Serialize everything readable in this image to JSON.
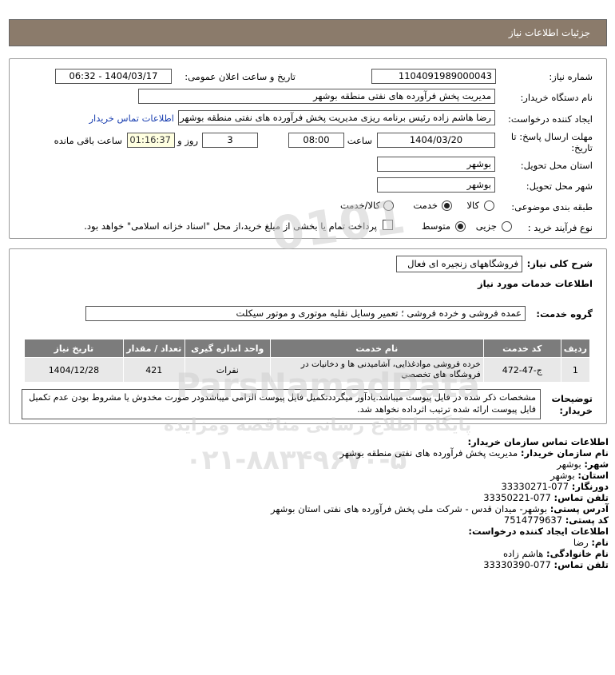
{
  "header": {
    "title": "جزئیات اطلاعات نیاز"
  },
  "need": {
    "number_label": "شماره نیاز:",
    "number_value": "1104091989000043",
    "announce_label": "تاریخ و ساعت اعلان عمومی:",
    "announce_value": "1404/03/17 - 06:32",
    "buyer_label": "نام دستگاه خریدار:",
    "buyer_value": "مدیریت پخش فرآورده های نفتی منطقه بوشهر",
    "creator_label": "ایجاد کننده درخواست:",
    "creator_value": "رضا هاشم زاده رئیس برنامه ریزی مدیریت پخش فرآورده های نفتی منطقه بوشهر",
    "contact_link": "اطلاعات تماس خریدار",
    "deadline_label_1": "مهلت ارسال پاسخ: تا",
    "deadline_label_2": "تاریخ:",
    "deadline_date": "1404/03/20",
    "time_label": "ساعت",
    "deadline_time": "08:00",
    "days_value": "3",
    "days_label": "روز و",
    "timer_value": "01:16:37",
    "remaining_label": "ساعت باقی مانده",
    "province_label": "استان محل تحویل:",
    "province_value": "بوشهر",
    "city_label": "شهر محل تحویل:",
    "city_value": "بوشهر",
    "category_label": "طبقه بندی موضوعی:",
    "category_options": [
      "کالا",
      "خدمت",
      "کالا/خدمت"
    ],
    "process_label": "نوع فرآیند خرید :",
    "process_options": [
      "جزیی",
      "متوسط"
    ],
    "payment_text": "پرداخت تمام یا بخشی از مبلغ خرید،از محل \"اسناد خزانه اسلامی\" خواهد بود."
  },
  "summary": {
    "title_label": "شرح کلی نیاز:",
    "title_value": "فروشگاههای زنجیره ای فعال",
    "services_heading": "اطلاعات خدمات مورد نیاز",
    "group_label": "گروه خدمت:",
    "group_value": "عمده فروشی و خرده فروشی ؛ تعمیر وسایل نقلیه موتوری و موتور سیکلت"
  },
  "table": {
    "headers": [
      "ردیف",
      "کد خدمت",
      "نام خدمت",
      "واحد اندازه گیری",
      "تعداد / مقدار",
      "تاریخ نیاز"
    ],
    "rows": [
      [
        "1",
        "ج-47-472",
        "خرده فروشی موادغذایی، آشامیدنی ها و دخانیات در فروشگاه های تخصصی",
        "نفرات",
        "421",
        "1404/12/28"
      ]
    ]
  },
  "notes": {
    "label_1": "توضیحات",
    "label_2": "خریدار:",
    "text": "مشخصات ذکر شده در فایل پیوست میباشد.یادآور میگرددتکمیل فایل پیوست الزامی میباشدودر صورت مخدوش یا مشروط بودن عدم تکمیل فایل پیوست ارائه شده ترتیب اثرداده نخواهد شد."
  },
  "contact": {
    "heading": "اطلاعات تماس سازمان خریدار:",
    "org_label": "نام سازمان خریدار:",
    "org_value": "مدیریت پخش فرآورده های نفتی منطقه بوشهر",
    "city_label": "شهر:",
    "city_value": "بوشهر",
    "province_label": "استان:",
    "province_value": "بوشهر",
    "fax_label": "دورنگار:",
    "fax_value": "077-33330271",
    "phone_label": "تلفن تماس:",
    "phone_value": "077-33350221",
    "address_label": "آدرس پستی:",
    "address_value": "بوشهر- میدان قدس - شرکت ملی پخش فرآورده های نفتی استان بوشهر",
    "postal_label": "کد پستی:",
    "postal_value": "7514779637",
    "creator_heading": "اطلاعات ایجاد کننده درخواست:",
    "name_label": "نام:",
    "name_value": "رضا",
    "family_label": "نام خانوادگی:",
    "family_value": "هاشم زاده",
    "creator_phone_label": "تلفن تماس:",
    "creator_phone_value": "077-33330390"
  },
  "watermark": {
    "line1": "ParsNamadData",
    "line2": "پایگاه اطلاع رسانی مناقصه ومزایده",
    "line3": "۰۲۱-۸۸۳۴۹۶۷۰-۵"
  }
}
